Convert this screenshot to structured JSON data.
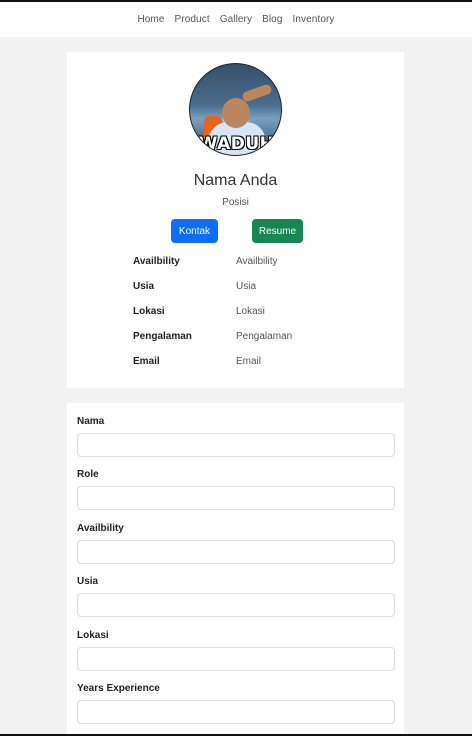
{
  "nav": {
    "items": [
      "Home",
      "Product",
      "Gallery",
      "Blog",
      "Inventory"
    ]
  },
  "profile": {
    "avatar_caption": "WADUH",
    "name": "Nama Anda",
    "position": "Posisi",
    "kontak_label": "Kontak",
    "resume_label": "Resume",
    "info": [
      {
        "key": "Availbility",
        "value": "Availbility"
      },
      {
        "key": "Usia",
        "value": "Usia"
      },
      {
        "key": "Lokasi",
        "value": "Lokasi"
      },
      {
        "key": "Pengalaman",
        "value": "Pengalaman"
      },
      {
        "key": "Email",
        "value": "Email"
      }
    ]
  },
  "form": {
    "fields": [
      {
        "label": "Nama",
        "value": ""
      },
      {
        "label": "Role",
        "value": ""
      },
      {
        "label": "Availbility",
        "value": ""
      },
      {
        "label": "Usia",
        "value": ""
      },
      {
        "label": "Lokasi",
        "value": ""
      },
      {
        "label": "Years Experience",
        "value": ""
      }
    ]
  },
  "colors": {
    "kontak_button": "#0d6efd",
    "resume_button": "#198754",
    "page_background": "#f2f2f2"
  }
}
